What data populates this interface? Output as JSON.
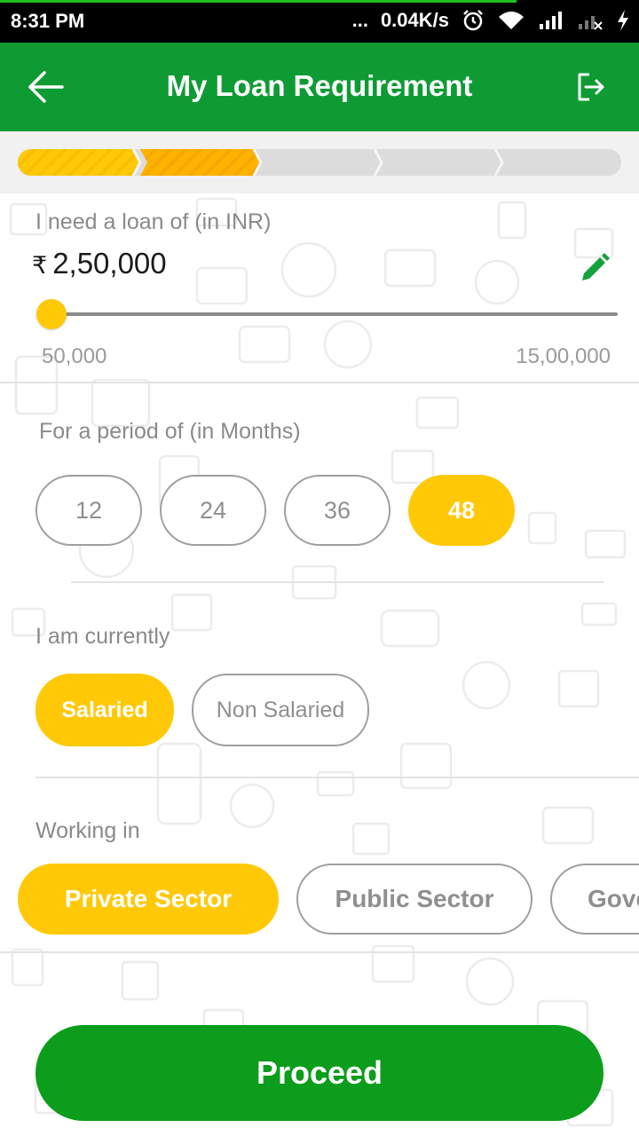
{
  "status_bar": {
    "time": "8:31 PM",
    "dots": "...",
    "network_speed": "0.04K/s"
  },
  "app_bar": {
    "title": "My Loan Requirement",
    "back_icon": "arrow-left-icon",
    "logout_icon": "logout-icon",
    "background": "#0e9b34"
  },
  "stepper": {
    "total_steps": 5,
    "completed_steps": 2,
    "colors": [
      "#ffc908",
      "#ffb300",
      "#dcdcdc"
    ]
  },
  "loan": {
    "label": "I need a loan of (in INR)",
    "currency_symbol": "₹",
    "amount": "2,50,000",
    "slider_min": "50,000",
    "slider_max": "15,00,000",
    "edit_icon": "pencil-icon"
  },
  "period": {
    "label": "For a period of (in Months)",
    "options": [
      "12",
      "24",
      "36",
      "48"
    ],
    "selected": "48"
  },
  "employment": {
    "label": "I am currently",
    "options": [
      "Salaried",
      "Non Salaried"
    ],
    "selected": "Salaried"
  },
  "sector": {
    "label": "Working in",
    "options": [
      "Private Sector",
      "Public Sector",
      "Gove"
    ],
    "selected": "Private Sector"
  },
  "proceed_label": "Proceed",
  "colors": {
    "accent_yellow": "#ffc908",
    "primary_green": "#0e9b34",
    "button_green": "#0c9d1c"
  }
}
